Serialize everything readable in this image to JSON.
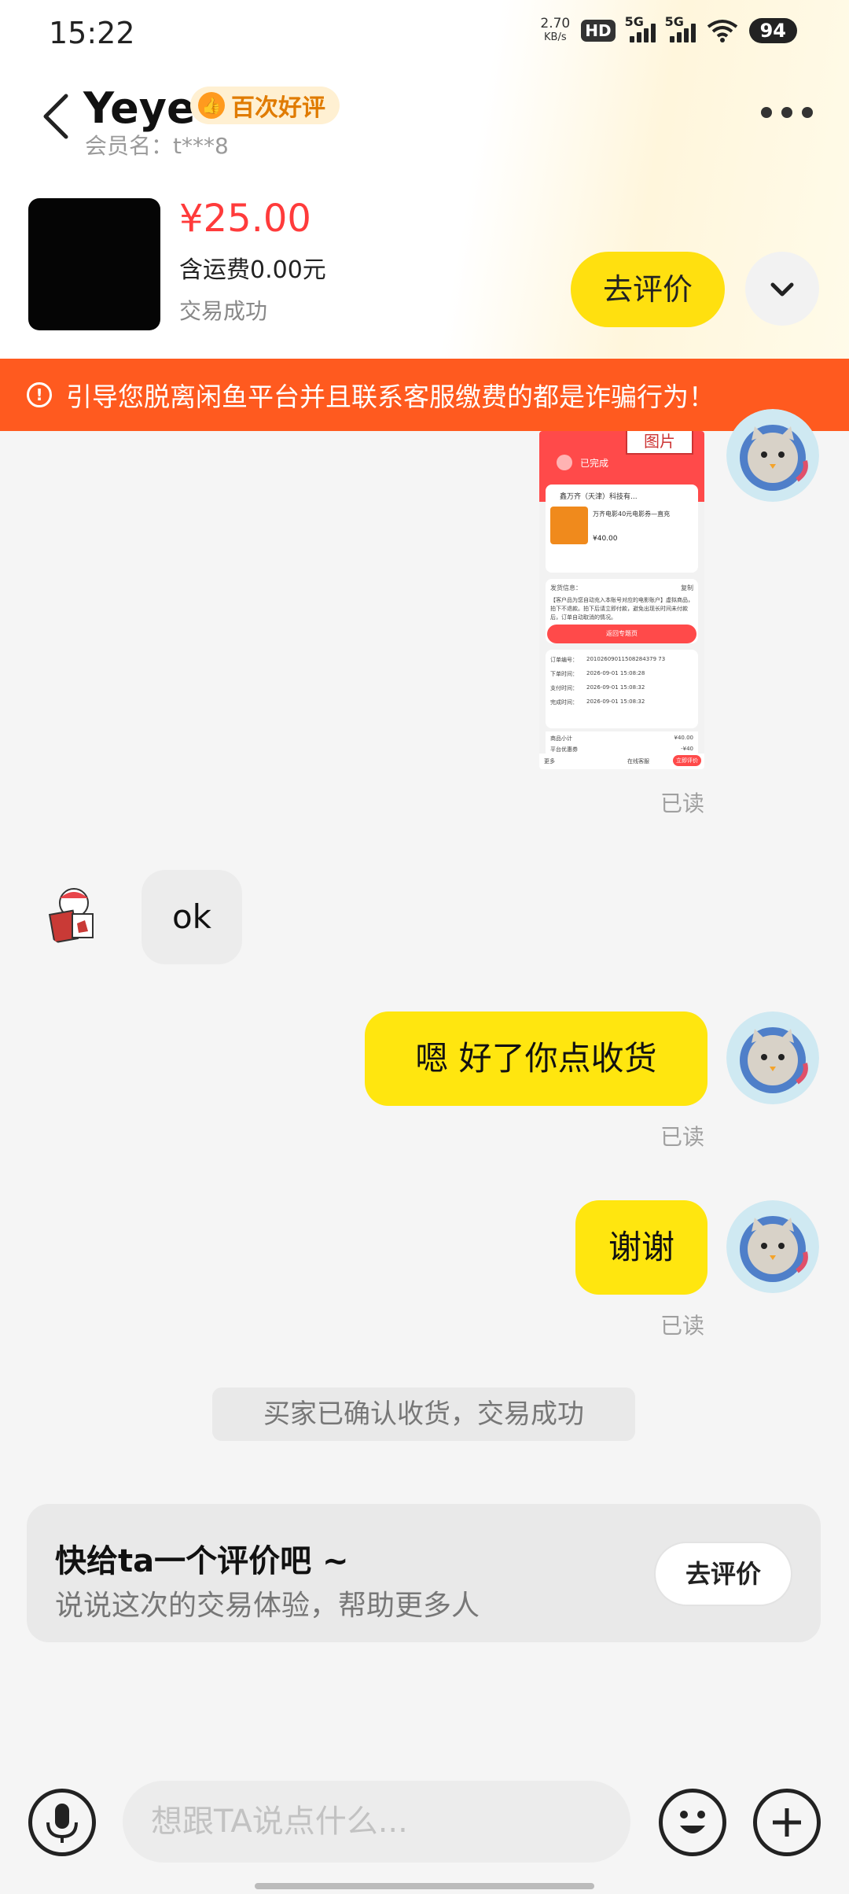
{
  "status_bar": {
    "time": "15:22",
    "net_speed": "2.70",
    "net_speed_unit": "KB/s",
    "hd_label": "HD",
    "sim1_label": "5G",
    "sim2_label": "5G",
    "battery": "94"
  },
  "header": {
    "seller_name": "Yeye",
    "badge_label": "百次好评",
    "member_label": "会员名：t***8"
  },
  "product": {
    "price": "¥25.00",
    "shipping": "含运费0.00元",
    "status": "交易成功",
    "rate_button": "去评价"
  },
  "warning": {
    "text": "引导您脱离闲鱼平台并且联系客服缴费的都是诈骗行为！"
  },
  "screenshot_message": {
    "header_label": "图片",
    "status": "已完成",
    "shop": "鑫万齐（天津）科技有...",
    "item_title": "万齐电影40元电影券—直充",
    "item_price": "¥40.00",
    "section_label": "发货信息：",
    "copy_label": "复制",
    "notice": "【客户品为您自动充入本账号对应的电影账户】虚拟商品，拍下不退款。拍下后请立即付款，避免出现长时间未付款后，订单自动取消的情况。",
    "cta": "返回专题页",
    "order_no_label": "订单编号：",
    "order_no": "20102609011508284379 73",
    "order_time_label": "下单时间：",
    "order_time": "2026-09-01 15:08:28",
    "pay_time_label": "支付时间：",
    "pay_time": "2026-09-01 15:08:32",
    "done_time_label": "完成时间：",
    "done_time": "2026-09-01 15:08:32",
    "subtotal_label": "商品小计",
    "subtotal": "¥40.00",
    "fee_label": "平台优惠券",
    "fee": "-¥40",
    "bottom_left": "更多",
    "service_btn": "在线客服",
    "review_btn": "立即评价"
  },
  "messages": {
    "read_1": "已读",
    "other_text": "ok",
    "me_text_1": "嗯  好了你点收货",
    "read_2": "已读",
    "me_text_2": "谢谢",
    "read_3": "已读",
    "system_text": "买家已确认收货，交易成功"
  },
  "review_card": {
    "title": "快给ta一个评价吧 ~",
    "subtitle": "说说这次的交易体验，帮助更多人",
    "button": "去评价"
  },
  "input_bar": {
    "placeholder": "想跟TA说点什么..."
  },
  "colors": {
    "accent_yellow": "#ffe60f",
    "warning_orange": "#ff5a1f",
    "price_red": "#ff3b3b"
  },
  "icons": [
    "back-arrow-icon",
    "thumb-up-icon",
    "more-dots-icon",
    "chevron-down-icon",
    "warning-icon",
    "mic-icon",
    "emoji-icon",
    "plus-icon"
  ]
}
